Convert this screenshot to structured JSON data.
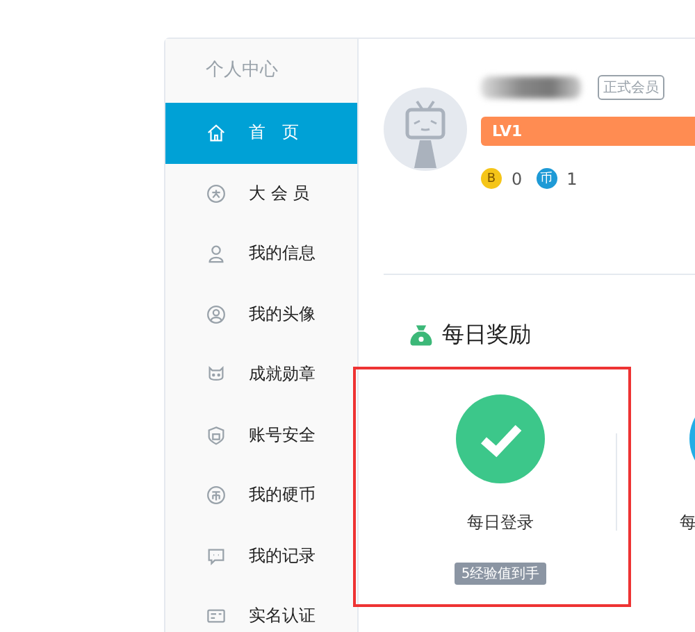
{
  "sidebar": {
    "title": "个人中心",
    "items": [
      {
        "label": "首　页",
        "selected": true
      },
      {
        "label": "大 会 员",
        "selected": false
      },
      {
        "label": "我的信息",
        "selected": false
      },
      {
        "label": "我的头像",
        "selected": false
      },
      {
        "label": "成就勋章",
        "selected": false
      },
      {
        "label": "账号安全",
        "selected": false
      },
      {
        "label": "我的硬币",
        "selected": false
      },
      {
        "label": "我的记录",
        "selected": false
      },
      {
        "label": "实名认证",
        "selected": false
      }
    ]
  },
  "profile": {
    "member_badge": "正式会员",
    "level": "LV1",
    "coins": [
      {
        "symbol": "B",
        "value": "0",
        "color": "#f5c518"
      },
      {
        "symbol": "币",
        "value": "1",
        "color": "#1e9ad6"
      }
    ]
  },
  "daily_reward": {
    "title": "每日奖励",
    "tasks": [
      {
        "label": "每日登录",
        "done": true,
        "highlighted": true,
        "reward": "5经验值到手"
      },
      {
        "label": "每",
        "done": false
      }
    ]
  }
}
